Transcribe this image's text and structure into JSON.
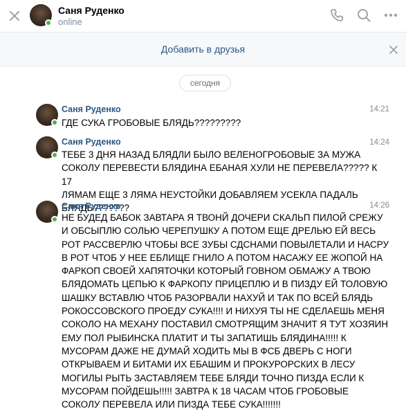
{
  "header": {
    "name": "Саня Руденко",
    "status": "online",
    "icons": [
      "close-icon",
      "phone-icon",
      "search-icon",
      "more-icon"
    ]
  },
  "friend_bar": {
    "label": "Добавить в друзья"
  },
  "date_divider": "сегодня",
  "messages": [
    {
      "author": "Саня Руденко",
      "time": "14:21",
      "text": "ГДЕ СУКА ГРОБОВЫЕ БЛЯДЬ?????????"
    },
    {
      "author": "Саня Руденко",
      "time": "14:24",
      "text": "ТЕБЕ 3 ДНЯ НАЗАД БЛЯДЛИ БЫЛО ВЕЛЕНОГРОБОВЫЕ ЗА МУЖА\nСОКОЛУ ПЕРЕВЕСТИ БЛЯДИНА ЕБАНАЯ ХУЛИ НЕ ПЕРЕВЕЛА????? К 17\nЛЯМАМ ЕЩЕ 3 ЛЯМА НЕУСТОЙКИ ДОБАВЛЯЕМ УСЕКЛА ПАДАЛЬ\nБЛЯДЬ???????"
    },
    {
      "author": "Саня Руденко",
      "time": "14:26",
      "text": "НЕ БУДЕД БАБОК ЗАВТАРА Я ТВОНЙ ДОЧЕРИ СКАЛЬП ПИЛОЙ СРЕЖУ\nИ ОБСЫПЛЮ СОЛЬЮ ЧЕРЕПУШКУ А ПОТОМ ЕЩЕ ДРЕЛЬЮ ЕЙ ВЕСЬ\nРОТ РАССВЕРЛЮ ЧТОБЫ ВСЕ ЗУБЫ СДСНАМИ ПОВЫЛЕТАЛИ И НАСРУ\nВ РОТ ЧТОБ У НЕЕ ЕБЛИЩЕ ГНИЛО А ПОТОМ НАСАЖУ ЕЕ ЖОПОЙ НА\nФАРКОП СВОЕЙ ХАПЯТОЧКИ КОТОРЫЙ ГОВНОМ ОБМАЖУ А ТВОЮ\nБЛЯДОМАТЬ ЦЕПЬЮ К ФАРКОПУ ПРИЦЕПЛЮ И В ПИЗДУ ЕЙ ТОЛОВУЮ\nШАШКУ ВСТАВЛЮ ЧТОБ РАЗОРВАЛИ НАХУЙ И ТАК ПО ВСЕЙ БЛЯДЬ\nРОКОССОВСКОГО ПРОЕДУ СУКА!!!! И НИХУЯ ТЫ НЕ СДЕЛАЕШЬ МЕНЯ\nСОКОЛО НА МЕХАНУ ПОСТАВИЛ СМОТРЯЩИМ ЗНАЧИТ Я ТУТ ХОЗЯИН\nЕМУ ПОЛ РЫБИНСКА ПЛАТИТ И ТЫ ЗАПАТИШЬ БЛЯДИНА!!!!! К\nМУСОРАМ ДАЖЕ НЕ ДУМАЙ ХОДИТЬ МЫ В ФСБ ДВЕРЬ С НОГИ\nОТКРЫВАЕМ И БИТАМИ ИХ ЕБАШИМ И ПРОКУРОРСКИХ В ЛЕСУ\nМОГИЛЫ РЫТЬ ЗАСТАВЛЯЕМ ТЕБЕ БЛЯДИ ТОЧНО ПИЗДА ЕСЛИ К\nМУСОРАМ ПОЙДЕШЬ!!!!! ЗАВТРА К 18 ЧАСАМ ЧТОБ ГРОБОВЫЕ\nСОКОЛУ ПЕРЕВЕЛА ИЛИ ПИЗДА ТЕБЕ СУКА!!!!!!!"
    }
  ],
  "colors": {
    "link": "#2a5885",
    "meta": "#818c99",
    "online": "#4bb34b",
    "icon": "#99a2ad"
  }
}
